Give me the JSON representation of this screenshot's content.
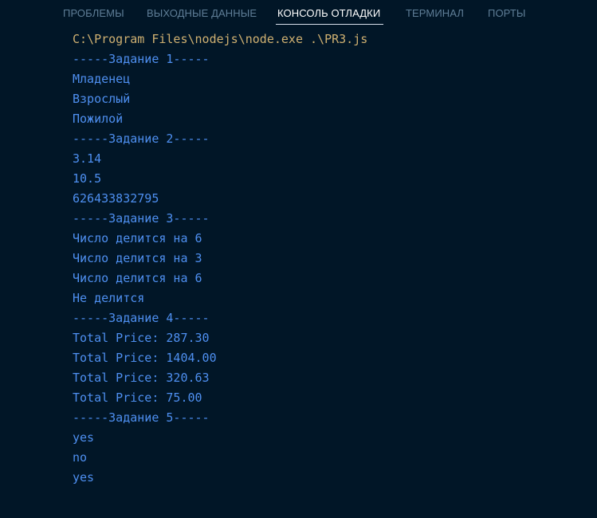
{
  "colors": {
    "background": "#011627",
    "tab_inactive": "#5f7e97",
    "tab_active": "#ffffff",
    "command_text": "#cfb071",
    "output_text": "#4e8ff0"
  },
  "tabs": [
    {
      "label": "ПРОБЛЕМЫ",
      "active": false
    },
    {
      "label": "ВЫХОДНЫЕ ДАННЫЕ",
      "active": false
    },
    {
      "label": "КОНСОЛЬ ОТЛАДКИ",
      "active": true
    },
    {
      "label": "ТЕРМИНАЛ",
      "active": false
    },
    {
      "label": "ПОРТЫ",
      "active": false
    }
  ],
  "console": {
    "command": "C:\\Program Files\\nodejs\\node.exe .\\PR3.js",
    "lines": [
      "-----Задание 1-----",
      "Младенец",
      "Взрослый",
      "Пожилой",
      "-----Задание 2-----",
      "3.14",
      "10.5",
      "626433832795",
      "-----Задание 3-----",
      "Число делится на 6",
      "Число делится на 3",
      "Число делится на 6",
      "Не делится",
      "-----Задание 4-----",
      "Total Price: 287.30",
      "Total Price: 1404.00",
      "Total Price: 320.63",
      "Total Price: 75.00",
      "-----Задание 5-----",
      "yes",
      "no",
      "yes"
    ]
  }
}
